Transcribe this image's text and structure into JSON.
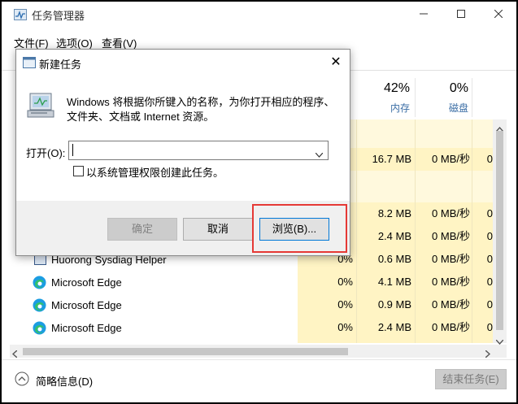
{
  "window": {
    "title": "任务管理器"
  },
  "menu": [
    "文件(F)",
    "选项(O)",
    "查看(V)"
  ],
  "columns": {
    "memory": {
      "percent": "42%",
      "label": "内存"
    },
    "disk": {
      "percent": "0%",
      "label": "磁盘"
    }
  },
  "rows": [
    {
      "name": "",
      "cpu": "",
      "mem": "16.7 MB",
      "disk": "0 MB/秒",
      "net": "0"
    },
    {
      "name": "",
      "cpu": "",
      "mem": "8.2 MB",
      "disk": "0 MB/秒",
      "net": "0"
    },
    {
      "name": "",
      "cpu": "",
      "mem": "2.4 MB",
      "disk": "0 MB/秒",
      "net": "0"
    },
    {
      "name": "Huorong Sysdiag Helper",
      "cpu": "0%",
      "mem": "0.6 MB",
      "disk": "0 MB/秒",
      "net": "0"
    },
    {
      "name": "Microsoft Edge",
      "cpu": "0%",
      "mem": "4.1 MB",
      "disk": "0 MB/秒",
      "net": "0"
    },
    {
      "name": "Microsoft Edge",
      "cpu": "0%",
      "mem": "0.9 MB",
      "disk": "0 MB/秒",
      "net": "0"
    },
    {
      "name": "Microsoft Edge",
      "cpu": "0%",
      "mem": "2.4 MB",
      "disk": "0 MB/秒",
      "net": "0"
    }
  ],
  "footer": {
    "brief_label": "简略信息(D)",
    "end_task_label": "结束任务(E)"
  },
  "dialog": {
    "title": "新建任务",
    "description": "Windows 将根据你所键入的名称，为你打开相应的程序、文件夹、文档或 Internet 资源。",
    "open_label": "打开(O):",
    "open_value": "",
    "admin_label": "以系统管理权限创建此任务。",
    "ok_label": "确定",
    "cancel_label": "取消",
    "browse_label": "浏览(B)..."
  },
  "colors": {
    "highlight": "#e53935",
    "heat_yellow": "#fff4c4"
  }
}
